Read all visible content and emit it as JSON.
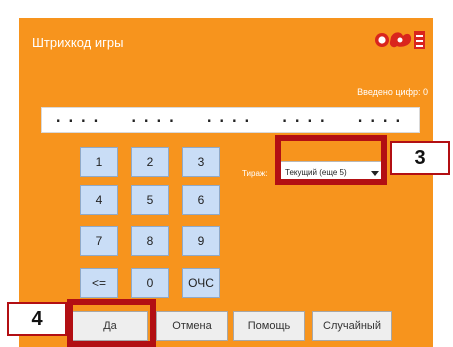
{
  "title": "Штрихкод игры",
  "digits_entered": "Введено цифр: 0",
  "code": "....  ....  ....  ....  ....",
  "keypad": [
    "1",
    "2",
    "3",
    "4",
    "5",
    "6",
    "7",
    "8",
    "9",
    "<=",
    "0",
    "ОЧС"
  ],
  "tirage_label": "Тираж:",
  "tirage_value": "Текущий (еще 5)",
  "buttons": {
    "yes": "Да",
    "cancel": "Отмена",
    "help": "Помощь",
    "random": "Случайный"
  },
  "callouts": {
    "dropdown": "3",
    "confirm": "4"
  },
  "colors": {
    "background": "#f7941d",
    "highlight": "#b20f13",
    "key": "#c9ddf6"
  },
  "logo_icon": "lotto-logo-icon"
}
